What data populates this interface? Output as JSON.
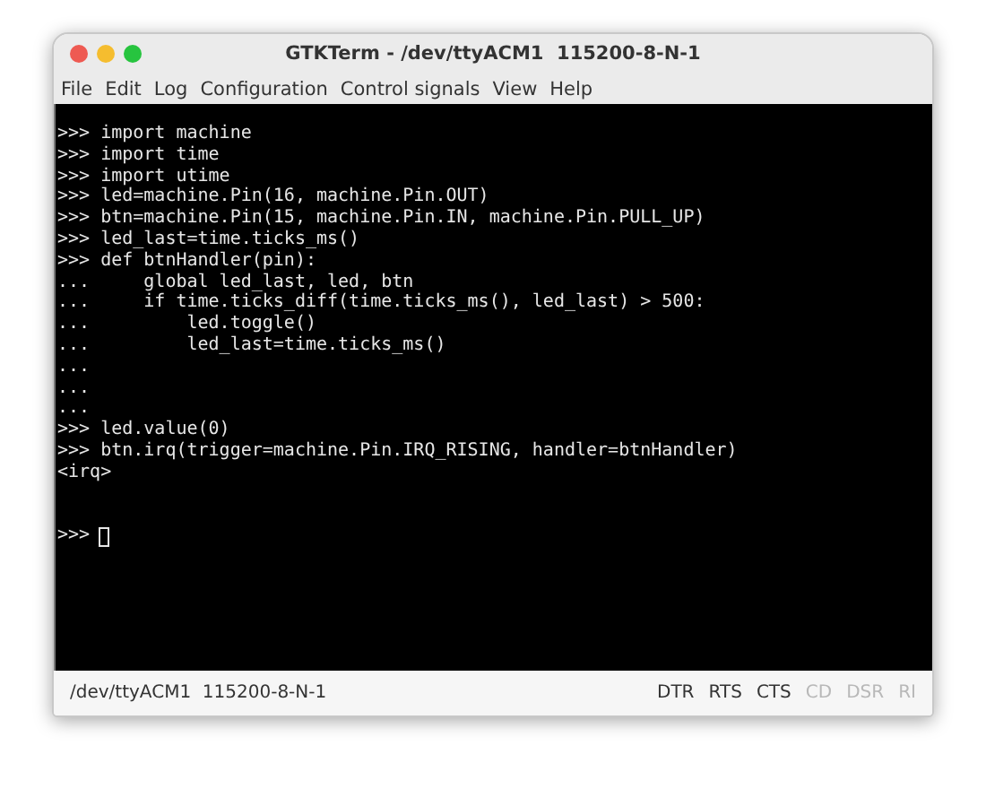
{
  "window": {
    "title": "GTKTerm - /dev/ttyACM1  115200-8-N-1"
  },
  "menu": [
    "File",
    "Edit",
    "Log",
    "Configuration",
    "Control signals",
    "View",
    "Help"
  ],
  "terminal": {
    "lines": [
      ">>> import machine",
      ">>> import time",
      ">>> import utime",
      ">>> led=machine.Pin(16, machine.Pin.OUT)",
      ">>> btn=machine.Pin(15, machine.Pin.IN, machine.Pin.PULL_UP)",
      ">>> led_last=time.ticks_ms()",
      ">>> def btnHandler(pin):",
      "...     global led_last, led, btn",
      "...     if time.ticks_diff(time.ticks_ms(), led_last) > 500:",
      "...         led.toggle()",
      "...         led_last=time.ticks_ms()",
      "...",
      "...",
      "...",
      ">>> led.value(0)",
      ">>> btn.irq(trigger=machine.Pin.IRQ_RISING, handler=btnHandler)",
      "<irq>"
    ],
    "prompt": ">>>"
  },
  "status_bar": {
    "port": "/dev/ttyACM1  115200-8-N-1",
    "signals": [
      {
        "label": "DTR",
        "on": true
      },
      {
        "label": "RTS",
        "on": true
      },
      {
        "label": "CTS",
        "on": true
      },
      {
        "label": "CD",
        "on": false
      },
      {
        "label": "DSR",
        "on": false
      },
      {
        "label": "RI",
        "on": false
      }
    ]
  }
}
